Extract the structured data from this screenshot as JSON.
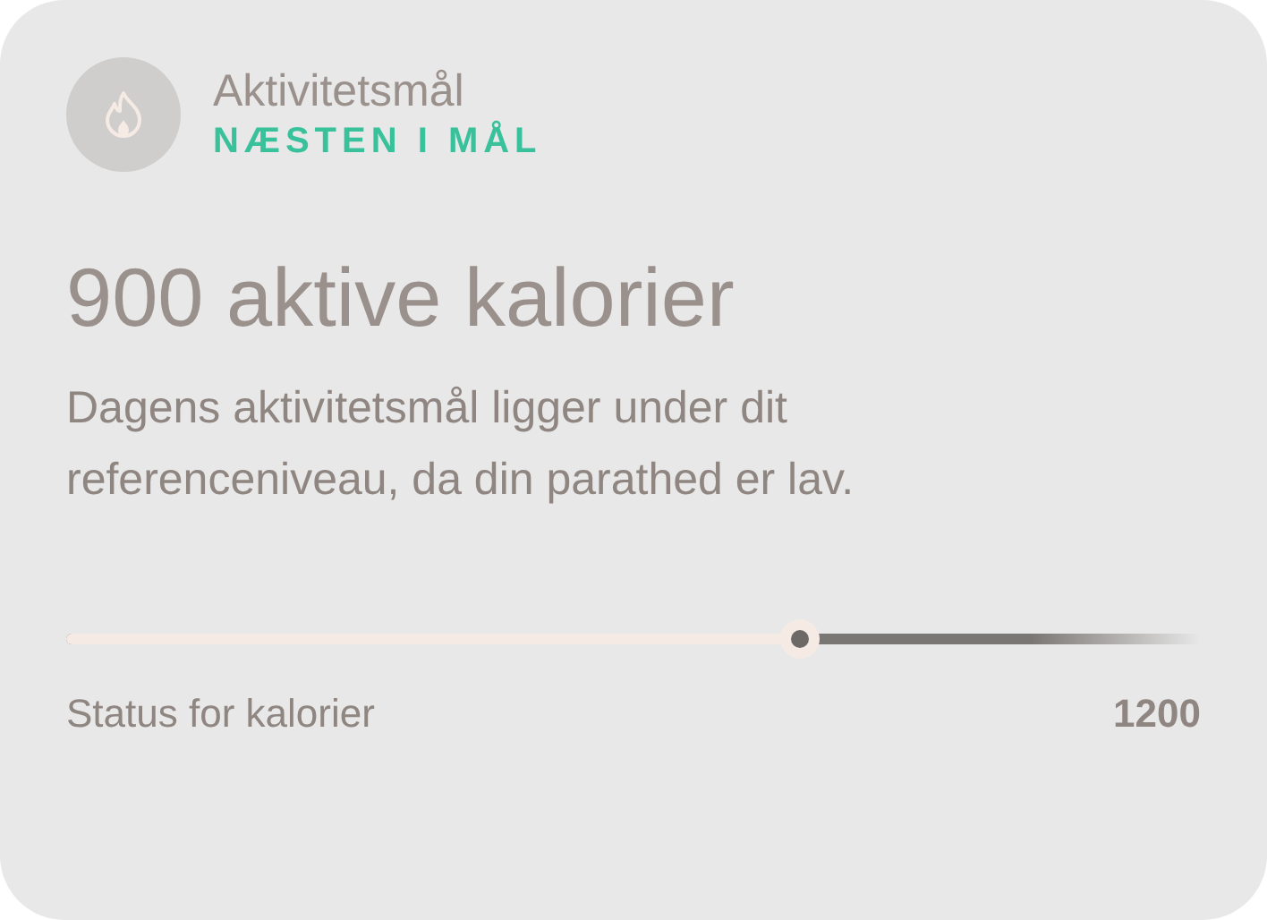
{
  "header": {
    "title": "Aktivitetsmål",
    "status": "NÆSTEN I MÅL"
  },
  "headline": "900 aktive kalorier",
  "description": "Dagens aktivitetsmål ligger under dit referenceniveau, da din parathed er lav.",
  "progress": {
    "level": 0.646,
    "label": "Status for kalorier",
    "target": "1200"
  }
}
